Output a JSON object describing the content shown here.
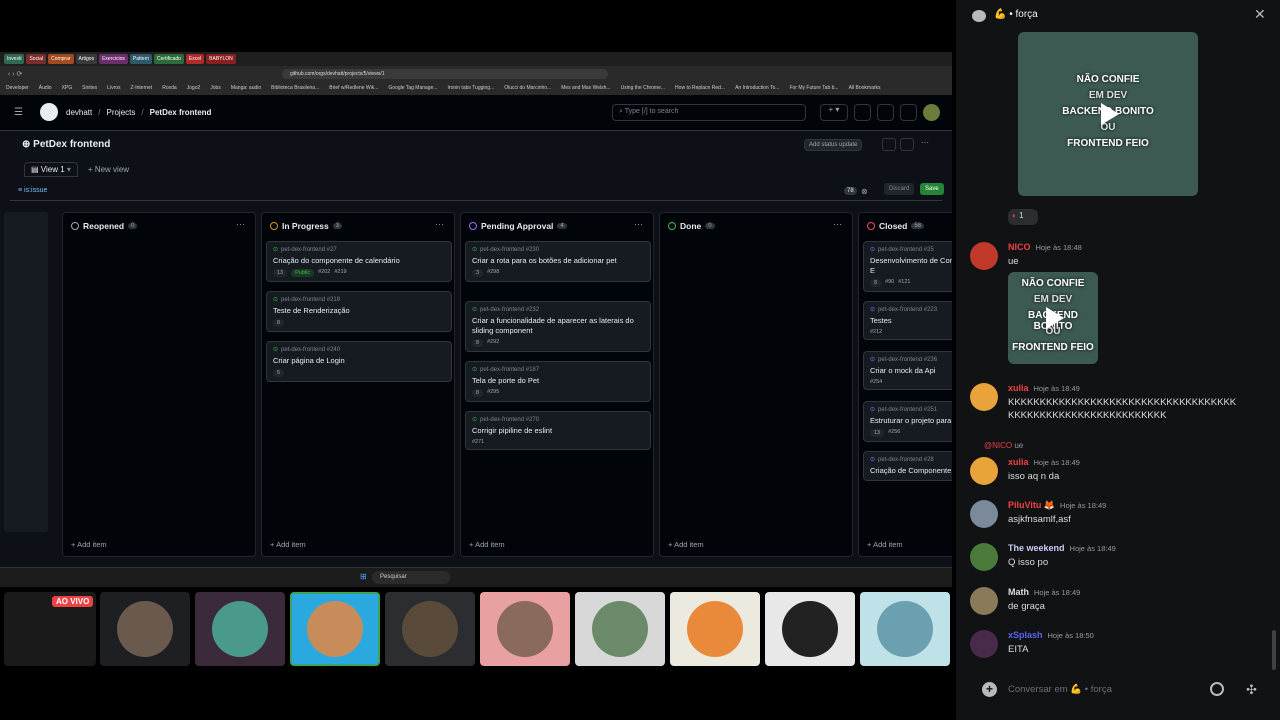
{
  "chat": {
    "channel_emoji": "💪",
    "channel_name": "• força",
    "reaction_count": "1",
    "placeholder": "Conversar em 💪 • força",
    "video_lines": [
      "NÃO CONFIE",
      "EM DEV",
      "BACKEND BONITO",
      "OU",
      "FRONTEND FEIO"
    ],
    "reply_ref": {
      "name": "@NICO",
      "text": "ue"
    },
    "messages": [
      {
        "name": "NICO",
        "time": "Hoje às 18:48",
        "text": "ue",
        "color": "#ed4245"
      },
      {
        "name": "xulia",
        "time": "Hoje às 18:49",
        "text": "KKKKKKKKKKKKKKKKKKKKKKKKKKKKKKKKKKKKKKKKKKKKKKKKKKKKKKKKKKKKK",
        "color": "#ed4245"
      },
      {
        "name": "xulia",
        "time": "Hoje às 18:49",
        "text": "isso aq n da",
        "color": "#ed4245"
      },
      {
        "name": "PiluVitu 🦊",
        "time": "Hoje às 18:49",
        "text": "asjkfnsamlf,asf",
        "color": "#ed4245"
      },
      {
        "name": "The weekend",
        "time": "Hoje às 18:49",
        "text": "Q isso po",
        "color": "#c9cdfb"
      },
      {
        "name": "Math",
        "time": "Hoje às 18:49",
        "text": "de graça",
        "color": "#dbdee1"
      },
      {
        "name": "xSplash",
        "time": "Hoje às 18:50",
        "text": "EITA",
        "color": "#5865f2"
      }
    ]
  },
  "stream": {
    "live_badge": "AO VIVO"
  },
  "browser": {
    "tabs": [
      "Investi",
      "Social",
      "Comprar",
      "Artigos",
      "Exercicios",
      "Pattern",
      "Certificado",
      "Excel",
      "BABYLON"
    ],
    "url": "github.com/orgs/devhatt/projects/5/views/1",
    "bookmarks": [
      "Developer",
      "Áudio",
      "XPG",
      "Sinites",
      "Livros",
      "Z-Internet",
      "Roxda",
      "Jogo2",
      "Jobs",
      "Manga: audio",
      "Biblioteca Brasileira...",
      "Brief w/Redlene Wik...",
      "Google Tag Manage...",
      "Ironin tabs Tugging...",
      "Olucci do Marcinho...",
      "Mes and Max Welsh...",
      "Using the Chrome...",
      "How to Replace Red...",
      "An Introduction To...",
      "For My Future Tab b...",
      "All Bookmarks"
    ]
  },
  "github": {
    "breadcrumb": [
      "devhatt",
      "Projects",
      "PetDex frontend"
    ],
    "search_placeholder": "Type [/] to search",
    "project_title": "PetDex frontend",
    "add_status": "Add status update",
    "view_tab": "View 1",
    "new_view": "New view",
    "filter": "is:issue",
    "filter_count": "78",
    "discard": "Discard",
    "save": "Save",
    "add_item": "Add item",
    "columns": [
      {
        "title": "Reopened",
        "count": "0",
        "color": "#9da7b3",
        "cards": []
      },
      {
        "title": "In Progress",
        "count": "3",
        "color": "#d29922",
        "cards": [
          {
            "repo": "pet-dex-frontend #27",
            "title": "Criação do componente de calendário",
            "meta": [
              "13",
              "Public",
              "#202",
              "#219"
            ]
          },
          {
            "repo": "pet-dex-frontend #218",
            "title": "Teste de Renderização",
            "meta": [
              "8"
            ]
          },
          {
            "repo": "pet-dex-frontend #240",
            "title": "Criar página de Login",
            "meta": [
              "5"
            ]
          }
        ]
      },
      {
        "title": "Pending Approval",
        "count": "4",
        "color": "#a371f7",
        "cards": [
          {
            "repo": "pet-dex-frontend #230",
            "title": "Criar a rota para os botões de adicionar pet",
            "meta": [
              "3",
              "#298"
            ]
          },
          {
            "repo": "pet-dex-frontend #232",
            "title": "Criar a funcionalidade de aparecer as laterais do sliding component",
            "meta": [
              "8",
              "#292"
            ]
          },
          {
            "repo": "pet-dex-frontend #187",
            "title": "Tela de porte do Pet",
            "meta": [
              "8",
              "#295"
            ]
          },
          {
            "repo": "pet-dex-frontend #270",
            "title": "Corrigir pipiline de eslint",
            "meta": [
              "#271"
            ]
          }
        ]
      },
      {
        "title": "Done",
        "count": "0",
        "color": "#3fb950",
        "cards": []
      },
      {
        "title": "Closed",
        "count": "58",
        "color": "#f85149",
        "cards": [
          {
            "repo": "pet-dex-frontend #25",
            "title": "Desenvolvimento de Com Radio e Checkbox com E",
            "meta": [
              "8",
              "#90",
              "#121"
            ]
          },
          {
            "repo": "pet-dex-frontend #223",
            "title": "Testes",
            "meta": [
              "#212"
            ]
          },
          {
            "repo": "pet-dex-frontend #236",
            "title": "Criar o mock da Api",
            "meta": [
              "#254"
            ]
          },
          {
            "repo": "pet-dex-frontend #251",
            "title": "Estruturar o projeto para SPA",
            "meta": [
              "13",
              "#256"
            ]
          },
          {
            "repo": "pet-dex-frontend #28",
            "title": "Criação de Componente Navegação entre Conte",
            "meta": []
          }
        ]
      }
    ],
    "taskbar_search": "Pesquisar"
  }
}
